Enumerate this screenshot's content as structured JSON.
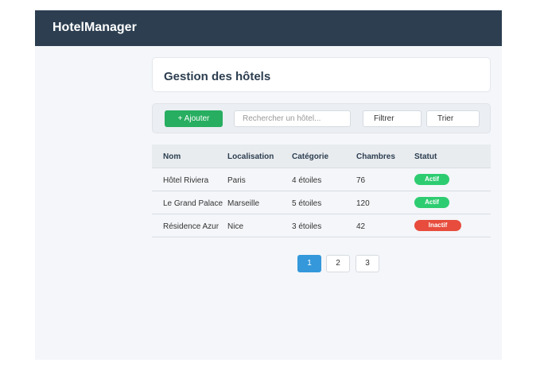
{
  "app": {
    "brand": "HotelManager"
  },
  "page": {
    "title": "Gestion des hôtels"
  },
  "toolbar": {
    "add_label": "+ Ajouter",
    "search_placeholder": "Rechercher un hôtel...",
    "filter_label": "Filtrer",
    "sort_label": "Trier"
  },
  "table": {
    "headers": [
      "Nom",
      "Localisation",
      "Catégorie",
      "Chambres",
      "Statut"
    ],
    "rows": [
      {
        "name": "Hôtel Riviera",
        "location": "Paris",
        "category": "4 étoiles",
        "rooms": "76",
        "status": "Actif"
      },
      {
        "name": "Le Grand Palace",
        "location": "Marseille",
        "category": "5 étoiles",
        "rooms": "120",
        "status": "Actif"
      },
      {
        "name": "Résidence Azur",
        "location": "Nice",
        "category": "3 étoiles",
        "rooms": "42",
        "status": "Inactif"
      }
    ]
  },
  "pagination": {
    "pages": [
      "1",
      "2",
      "3"
    ],
    "current": "1"
  },
  "colors": {
    "topbar": "#2c3e50",
    "add_button": "#27ae60",
    "status_active": "#2ecc71",
    "status_inactive": "#e74c3c",
    "page_current": "#3498db"
  }
}
